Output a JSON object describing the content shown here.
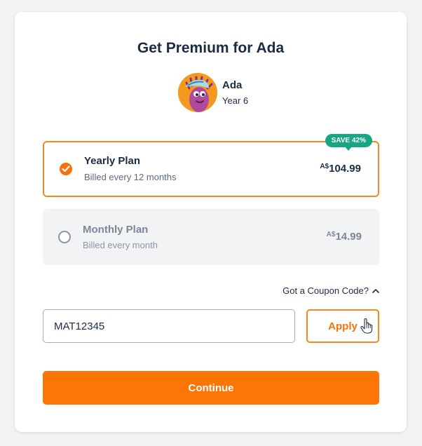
{
  "dialog": {
    "title": "Get Premium for Ada"
  },
  "child": {
    "name": "Ada",
    "year": "Year 6",
    "avatar_icon": "character-avatar-icon"
  },
  "plans": [
    {
      "name": "Yearly Plan",
      "billing": "Billed every 12 months",
      "currency": "A$",
      "price": "104.99",
      "badge": "SAVE 42%",
      "selected": true
    },
    {
      "name": "Monthly Plan",
      "billing": "Billed every month",
      "currency": "A$",
      "price": "14.99",
      "selected": false
    }
  ],
  "coupon": {
    "toggle_label": "Got a Coupon Code?",
    "value": "MAT12345",
    "apply_label": "Apply"
  },
  "continue_label": "Continue",
  "colors": {
    "accent": "#FD7407",
    "badge": "#16A683",
    "text": "#1C2B44"
  }
}
